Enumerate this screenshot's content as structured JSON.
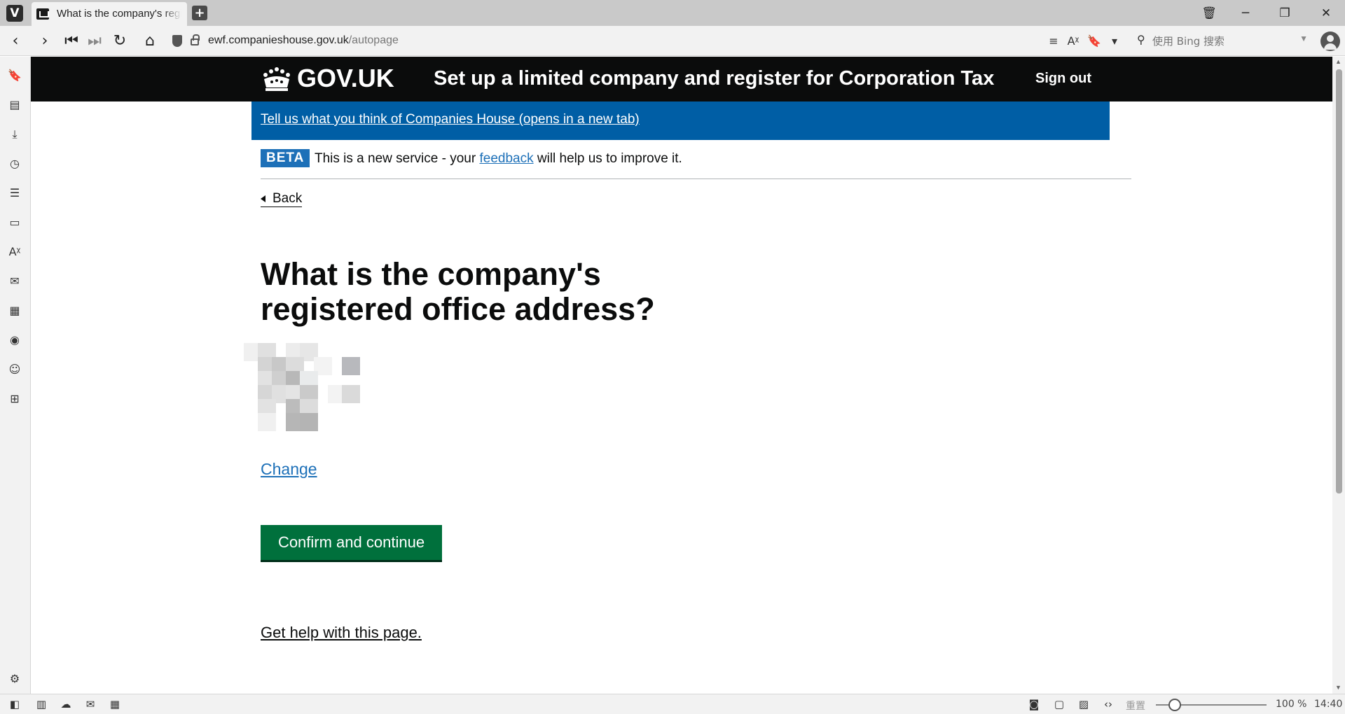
{
  "browser": {
    "tab_title": "What is the company's registered office address?",
    "new_tab": "+",
    "url_domain": "ewf.companieshouse.gov.uk",
    "url_path": "/autopage",
    "search_placeholder": "使用 Bing 搜索"
  },
  "header": {
    "logo_text": "GOV.UK",
    "service_name": "Set up a limited company and register for Corporation Tax",
    "sign_out": "Sign out"
  },
  "feedback_banner": {
    "link_text": "Tell us what you think of Companies House (opens in a new tab)"
  },
  "beta_banner": {
    "tag": "BETA",
    "text_before": "This is a new service - your ",
    "link_text": "feedback",
    "text_after": " will help us to improve it."
  },
  "back_link": "Back",
  "main": {
    "heading": "What is the company's registered office address?",
    "change_link": "Change",
    "confirm_button": "Confirm and continue",
    "help_link": "Get help with this page."
  },
  "statusbar": {
    "reset_label": "重置",
    "zoom": "100 %",
    "time": "14:40"
  },
  "colors": {
    "header_bg": "#0b0c0c",
    "banner_bg": "#005ea5",
    "link": "#1d70b8",
    "button_green": "#00703c"
  }
}
